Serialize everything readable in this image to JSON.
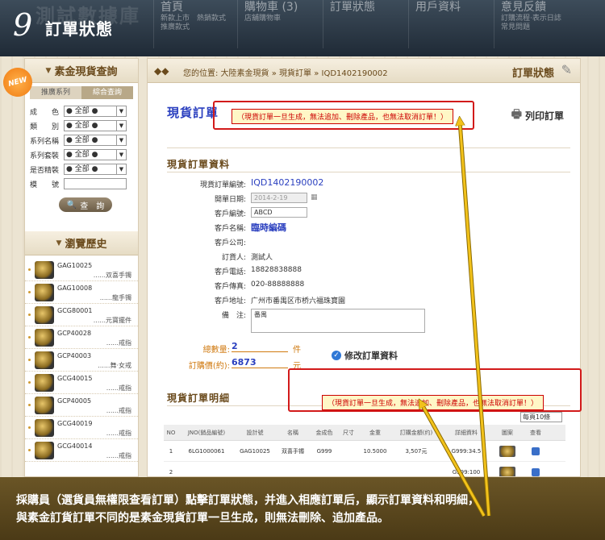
{
  "step": {
    "number": "9",
    "title": "訂單狀態"
  },
  "site": {
    "ghost_logo": "測試數據庫",
    "nav": [
      {
        "main": "首頁",
        "sub1": "新款上市　熱銷款式",
        "sub2": "推廣款式"
      },
      {
        "main": "購物車 (3)",
        "sub1": "店舖購物車",
        "sub2": ""
      },
      {
        "main": "訂單狀態",
        "sub1": "",
        "sub2": ""
      },
      {
        "main": "用戶資料",
        "sub1": "",
        "sub2": ""
      },
      {
        "main": "意見反饋",
        "sub1": "訂購流程·表示日誌",
        "sub2": "常見問題"
      }
    ]
  },
  "left": {
    "new_badge": "NEW",
    "panel_title": "素金現貨查詢",
    "tabs": [
      "推廣系列",
      "綜合查詢"
    ],
    "filters": [
      {
        "label": "成　　色",
        "value": "● 全部 ●"
      },
      {
        "label": "類　　別",
        "value": "● 全部 ●"
      },
      {
        "label": "系列名稱",
        "value": "● 全部 ●"
      },
      {
        "label": "系列套裝",
        "value": "● 全部 ●"
      },
      {
        "label": "是否精裝",
        "value": "● 全部 ●"
      }
    ],
    "model_label": "模　　號",
    "search_label": "查　詢",
    "history_title": "瀏覽歷史",
    "history": [
      {
        "code": "GAG10025",
        "name": "......双喜手镯"
      },
      {
        "code": "GAG10008",
        "name": "......龍手镯"
      },
      {
        "code": "GCG80001",
        "name": "......元寶擺件"
      },
      {
        "code": "GCP40028",
        "name": "......戒指"
      },
      {
        "code": "GCP40003",
        "name": "......舞·女戒"
      },
      {
        "code": "GCG40015",
        "name": "......戒指"
      },
      {
        "code": "GCP40005",
        "name": "......戒指"
      },
      {
        "code": "GCG40019",
        "name": "......戒指"
      },
      {
        "code": "GCG40014",
        "name": "......戒指"
      }
    ]
  },
  "main": {
    "breadcrumb": "您的位置: 大陸素金現貨 » 現貨訂單 » IQD1402190002",
    "page_title": "訂單狀態",
    "order_heading": "現貨訂單",
    "warning": "（現貨訂單一旦生成，無法追加、刪除產品，也無法取消訂單！）",
    "print_label": "列印訂單",
    "info_heading": "現貨訂單資料",
    "fields": {
      "order_no_label": "現貨訂單編號:",
      "order_no": "IQD1402190002",
      "date_label": "開單日期:",
      "date": "2014-2-19",
      "cust_no_label": "客戶編號:",
      "cust_no": "ABCD",
      "cust_name_label": "客戶名稱:",
      "cust_name": "臨時編碼",
      "company_label": "客戶公司:",
      "company": "",
      "orderer_label": "訂貨人:",
      "orderer": "測試人",
      "phone_label": "客戶電話:",
      "phone": "18828838888",
      "fax_label": "客戶傳真:",
      "fax": "020-88888888",
      "address_label": "客戶地址:",
      "address": "广州市番禺区市桥六福珠寶園",
      "remark_label": "備　注:",
      "remark": "番禺"
    },
    "totals": {
      "qty_label": "總數量:",
      "qty": "2",
      "qty_unit": "件",
      "price_label": "訂購價(約):",
      "price": "6873",
      "price_unit": "元"
    },
    "modify_label": "修改訂單資料",
    "detail_heading": "現貨訂單明細",
    "per_page": "每頁10條",
    "table": {
      "headers": [
        "NO",
        "JNO(銷品編號)",
        "設計號",
        "名稱",
        "金成色",
        "尺寸",
        "金重",
        "訂購金額(约)",
        "詳細資料",
        "圖案",
        "查看"
      ],
      "rows": [
        [
          "1",
          "6LG1000061",
          "GAG10025",
          "双喜手镯",
          "G999",
          "",
          "10.5000",
          "3,507元",
          "G999:34.5",
          "",
          ""
        ],
        [
          "2",
          "",
          "",
          "",
          "",
          "",
          "",
          "",
          "G999:100",
          "",
          ""
        ]
      ]
    }
  },
  "caption": {
    "line1": "採購員（選貨員無權限查看訂單）點擊訂單狀態，并進入相應訂單后，顯示訂單資料和明細，",
    "line2": "與素金訂貨訂單不同的是素金現貨訂單一旦生成，則無法刪除、追加產品。"
  },
  "colors": {
    "highlight_box": "#d21a1a",
    "arrow": "#f2c21b",
    "link_blue": "#2a3fbf"
  }
}
